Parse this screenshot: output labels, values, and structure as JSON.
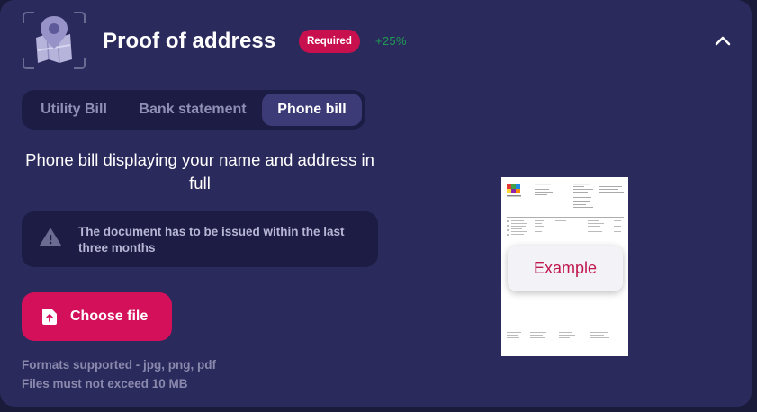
{
  "header": {
    "title": "Proof of address",
    "badge": "Required",
    "percent": "+25%",
    "icon": "location-pin-map-icon",
    "collapse_icon": "chevron-up-icon"
  },
  "tabs": [
    {
      "label": "Utility Bill",
      "active": false
    },
    {
      "label": "Bank statement",
      "active": false
    },
    {
      "label": "Phone bill",
      "active": true
    }
  ],
  "description": "Phone bill displaying your name and address in full",
  "notice": {
    "icon": "warning-icon",
    "text": "The document has to be issued within the last three months"
  },
  "upload": {
    "icon": "upload-icon",
    "label": "Choose file",
    "formats": "Formats supported - jpg, png, pdf",
    "size_limit": "Files must not exceed 10 MB"
  },
  "example": {
    "label": "Example"
  },
  "colors": {
    "card_bg": "#2b2a5c",
    "accent": "#d4105a",
    "success": "#1f9d55",
    "panel_bg": "#1c1c45"
  }
}
